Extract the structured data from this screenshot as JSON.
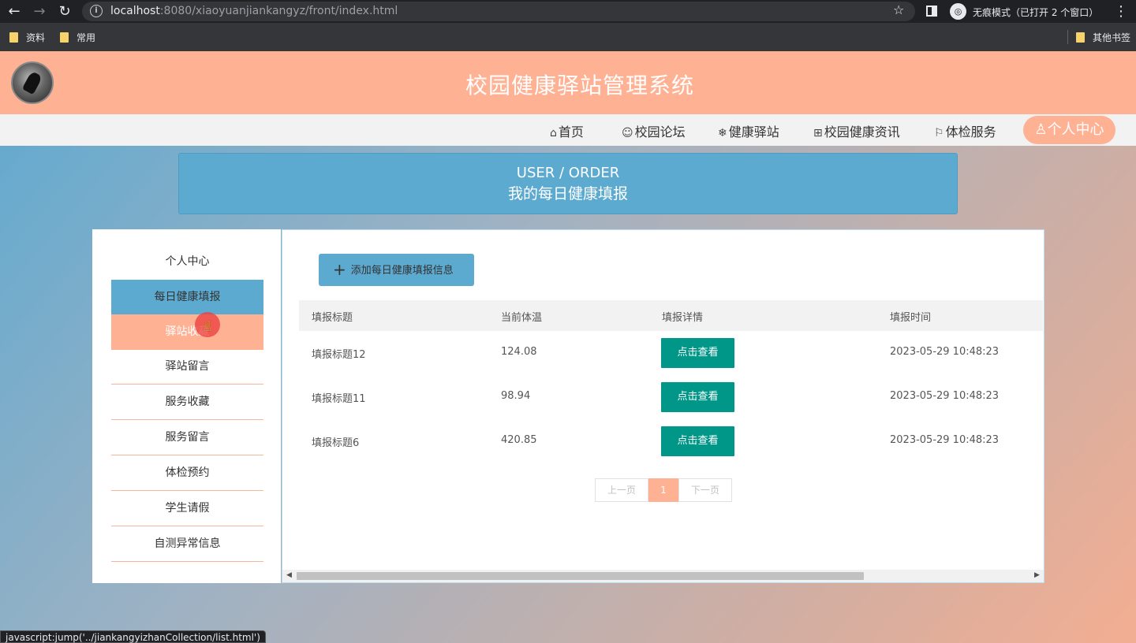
{
  "browser": {
    "url_host": "localhost",
    "url_port": ":8080",
    "url_path": "/xiaoyuanjiankangyz/front/index.html",
    "incognito_label": "无痕模式（已打开 2 个窗口）",
    "bookmarks": [
      "资料",
      "常用"
    ],
    "other_bookmarks": "其他书签",
    "status_url": "javascript:jump('../jiankangyizhanCollection/list.html')"
  },
  "site": {
    "title": "校园健康驿站管理系统"
  },
  "nav": {
    "items": [
      {
        "icon": "⌂",
        "label": "首页"
      },
      {
        "icon": "☺",
        "label": "校园论坛"
      },
      {
        "icon": "❄",
        "label": "健康驿站"
      },
      {
        "icon": "⊞",
        "label": "校园健康资讯"
      },
      {
        "icon": "⚐",
        "label": "体检服务"
      }
    ],
    "active": {
      "icon": "♙",
      "label": "个人中心"
    }
  },
  "banner": {
    "en": "USER / ORDER",
    "cn": "我的每日健康填报"
  },
  "sidebar": {
    "items": [
      "个人中心",
      "每日健康填报",
      "驿站收藏",
      "驿站留言",
      "服务收藏",
      "服务留言",
      "体检预约",
      "学生请假",
      "自测异常信息"
    ],
    "active_index": 1,
    "hover_index": 2
  },
  "main": {
    "add_button": "添加每日健康填报信息",
    "columns": [
      "填报标题",
      "当前体温",
      "填报详情",
      "填报时间"
    ],
    "rows": [
      {
        "title": "填报标题12",
        "temp": "124.08",
        "action": "点击查看",
        "time": "2023-05-29 10:48:23"
      },
      {
        "title": "填报标题11",
        "temp": "98.94",
        "action": "点击查看",
        "time": "2023-05-29 10:48:23"
      },
      {
        "title": "填报标题6",
        "temp": "420.85",
        "action": "点击查看",
        "time": "2023-05-29 10:48:23"
      }
    ],
    "pager": {
      "prev": "上一页",
      "current": "1",
      "next": "下一页"
    }
  },
  "colors": {
    "header": "#ffb194",
    "accent_blue": "#5daad0",
    "button_green": "#009688"
  }
}
